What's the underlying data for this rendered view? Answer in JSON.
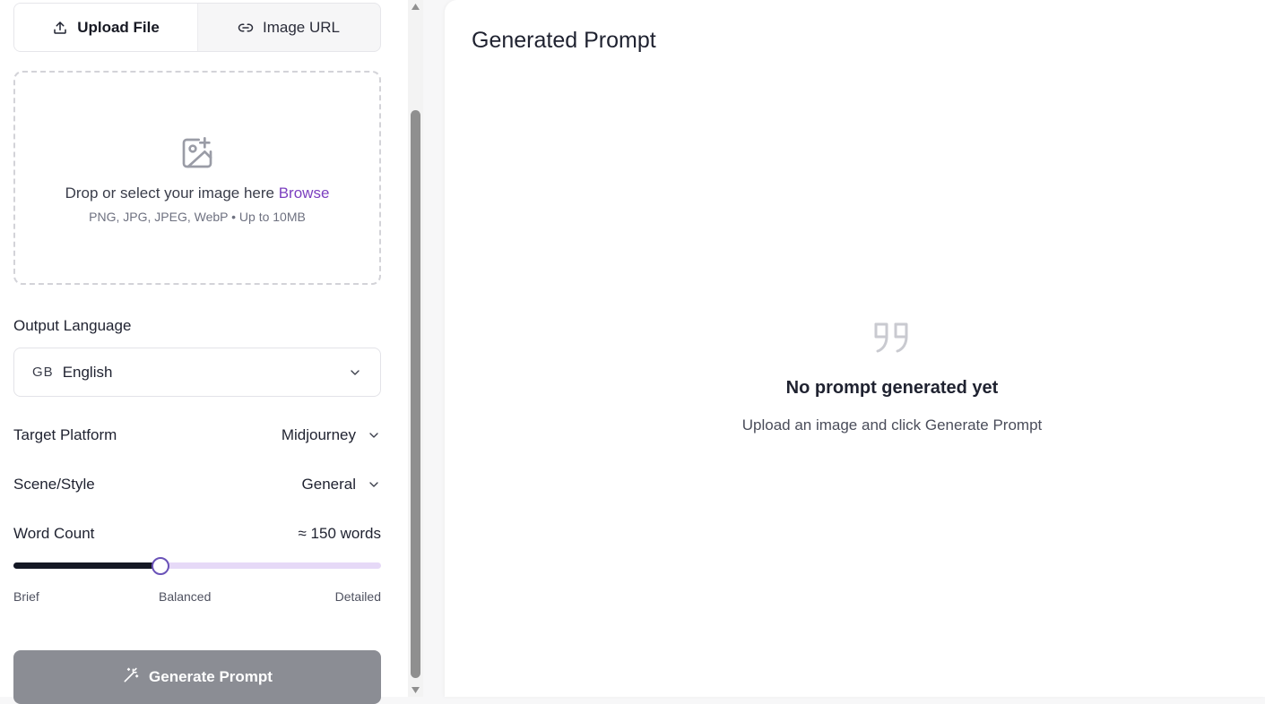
{
  "upload": {
    "tabs": [
      {
        "label": "Upload File",
        "icon": "upload-icon",
        "active": true
      },
      {
        "label": "Image URL",
        "icon": "link-icon",
        "active": false
      }
    ],
    "dropzone": {
      "icon": "image-plus-icon",
      "main_text": "Drop or select your image here",
      "browse_text": "Browse",
      "formats_text": "PNG, JPG, JPEG, WebP • Up to 10MB"
    }
  },
  "settings": {
    "output_language": {
      "label": "Output Language",
      "code": "GB",
      "value": "English"
    },
    "target_platform": {
      "label": "Target Platform",
      "value": "Midjourney"
    },
    "scene_style": {
      "label": "Scene/Style",
      "value": "General"
    },
    "word_count": {
      "label": "Word Count",
      "value_text": "≈ 150 words",
      "slider_fraction": 0.4,
      "scale_labels": [
        "Brief",
        "Balanced",
        "Detailed"
      ]
    }
  },
  "actions": {
    "generate_label": "Generate Prompt"
  },
  "result": {
    "title": "Generated Prompt",
    "empty_icon": "quote-icon",
    "empty_title": "No prompt generated yet",
    "empty_subtitle": "Upload an image and click Generate Prompt"
  },
  "colors": {
    "accent": "#7b3fbf",
    "slider_fill": "#141824",
    "slider_track": "#e6d9f7",
    "button_disabled": "#8b8d94"
  }
}
